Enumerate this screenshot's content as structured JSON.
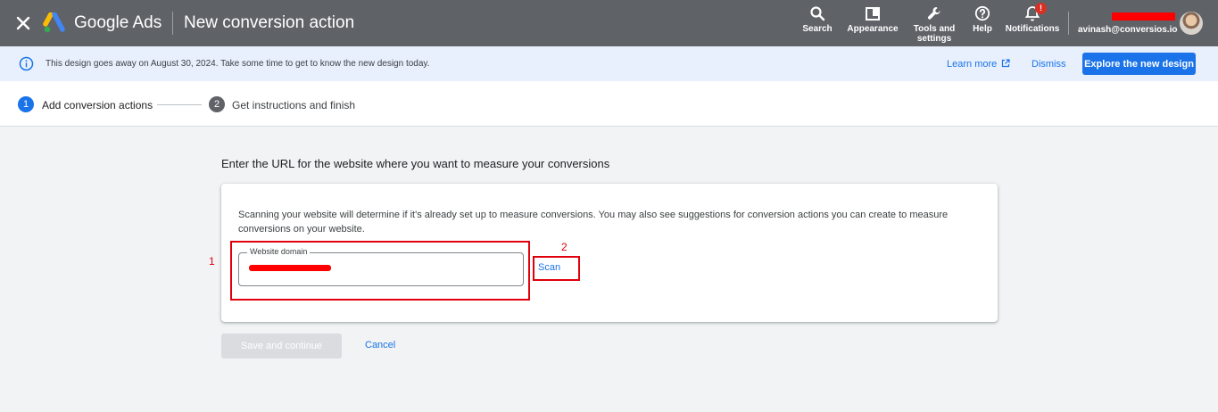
{
  "header": {
    "brand": "Google Ads",
    "page_title": "New conversion action",
    "tools": [
      {
        "icon": "search-icon",
        "label": "Search"
      },
      {
        "icon": "appearance-icon",
        "label": "Appearance"
      },
      {
        "icon": "wrench-icon",
        "label": "Tools and settings"
      },
      {
        "icon": "help-icon",
        "label": "Help"
      },
      {
        "icon": "bell-icon",
        "label": "Notifications"
      }
    ],
    "notification_badge": "!",
    "account_email": "avinash@conversios.io"
  },
  "banner": {
    "message": "This design goes away on August 30, 2024. Take some time to get to know the new design today.",
    "learn_more": "Learn more",
    "dismiss": "Dismiss",
    "explore": "Explore the new design"
  },
  "stepper": {
    "steps": [
      {
        "number": "1",
        "label": "Add conversion actions"
      },
      {
        "number": "2",
        "label": "Get instructions and finish"
      }
    ]
  },
  "main": {
    "heading": "Enter the URL for the website where you want to measure your conversions",
    "description": "Scanning your website will determine if it's already set up to measure conversions. You may also see suggestions for conversion actions you can create to measure conversions on your website.",
    "field_label": "Website domain",
    "scan_label": "Scan",
    "save_label": "Save and continue",
    "cancel_label": "Cancel"
  },
  "annotations": [
    "1",
    "2"
  ],
  "colors": {
    "topbar": "#5f6368",
    "accent": "#1a73e8",
    "annotation": "#e0000b",
    "banner": "#e8f0fe"
  }
}
